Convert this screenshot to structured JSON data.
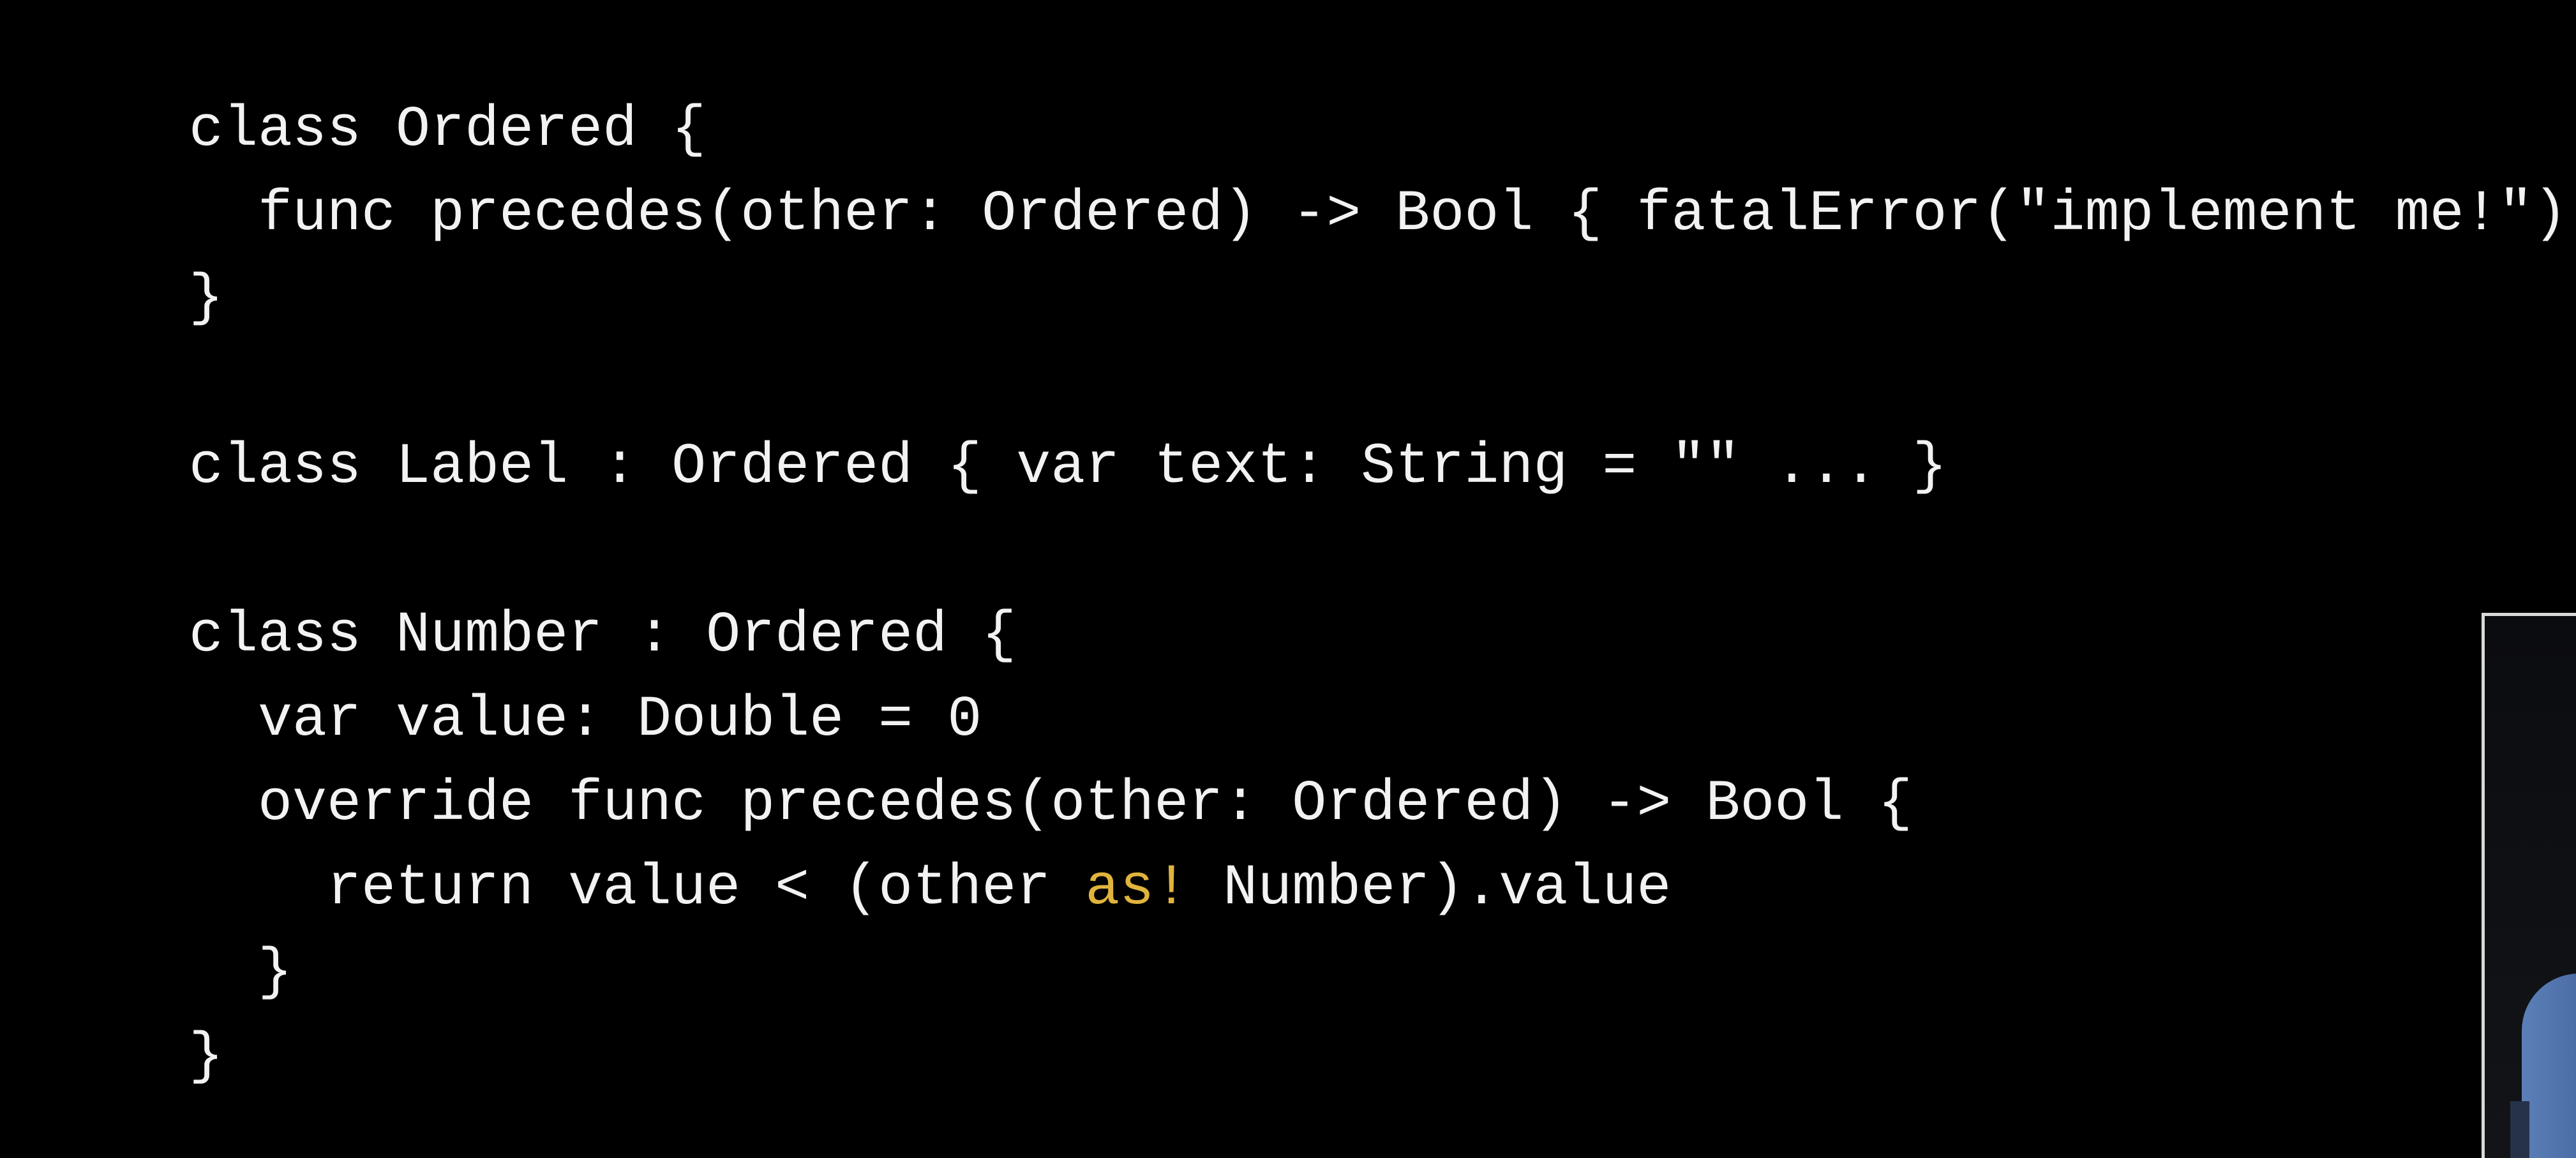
{
  "code": {
    "line_1": "class Ordered {",
    "line_2": "  func precedes(other: Ordered) -> Bool { fatalError(\"implement me!\") }",
    "line_3": "}",
    "line_4": "",
    "line_5": "class Label : Ordered { var text: String = \"\" ... }",
    "line_6": "",
    "line_7": "class Number : Ordered {",
    "line_8": "  var value: Double = 0",
    "line_9": "  override func precedes(other: Ordered) -> Bool {",
    "line_10_before": "    return value < (other ",
    "line_10_highlight": "as!",
    "line_10_after": " Number).value",
    "line_11": "  }",
    "line_12": "}"
  },
  "colors": {
    "background": "#000000",
    "code_text": "#f2f2f2",
    "highlight": "#e0b43c"
  }
}
